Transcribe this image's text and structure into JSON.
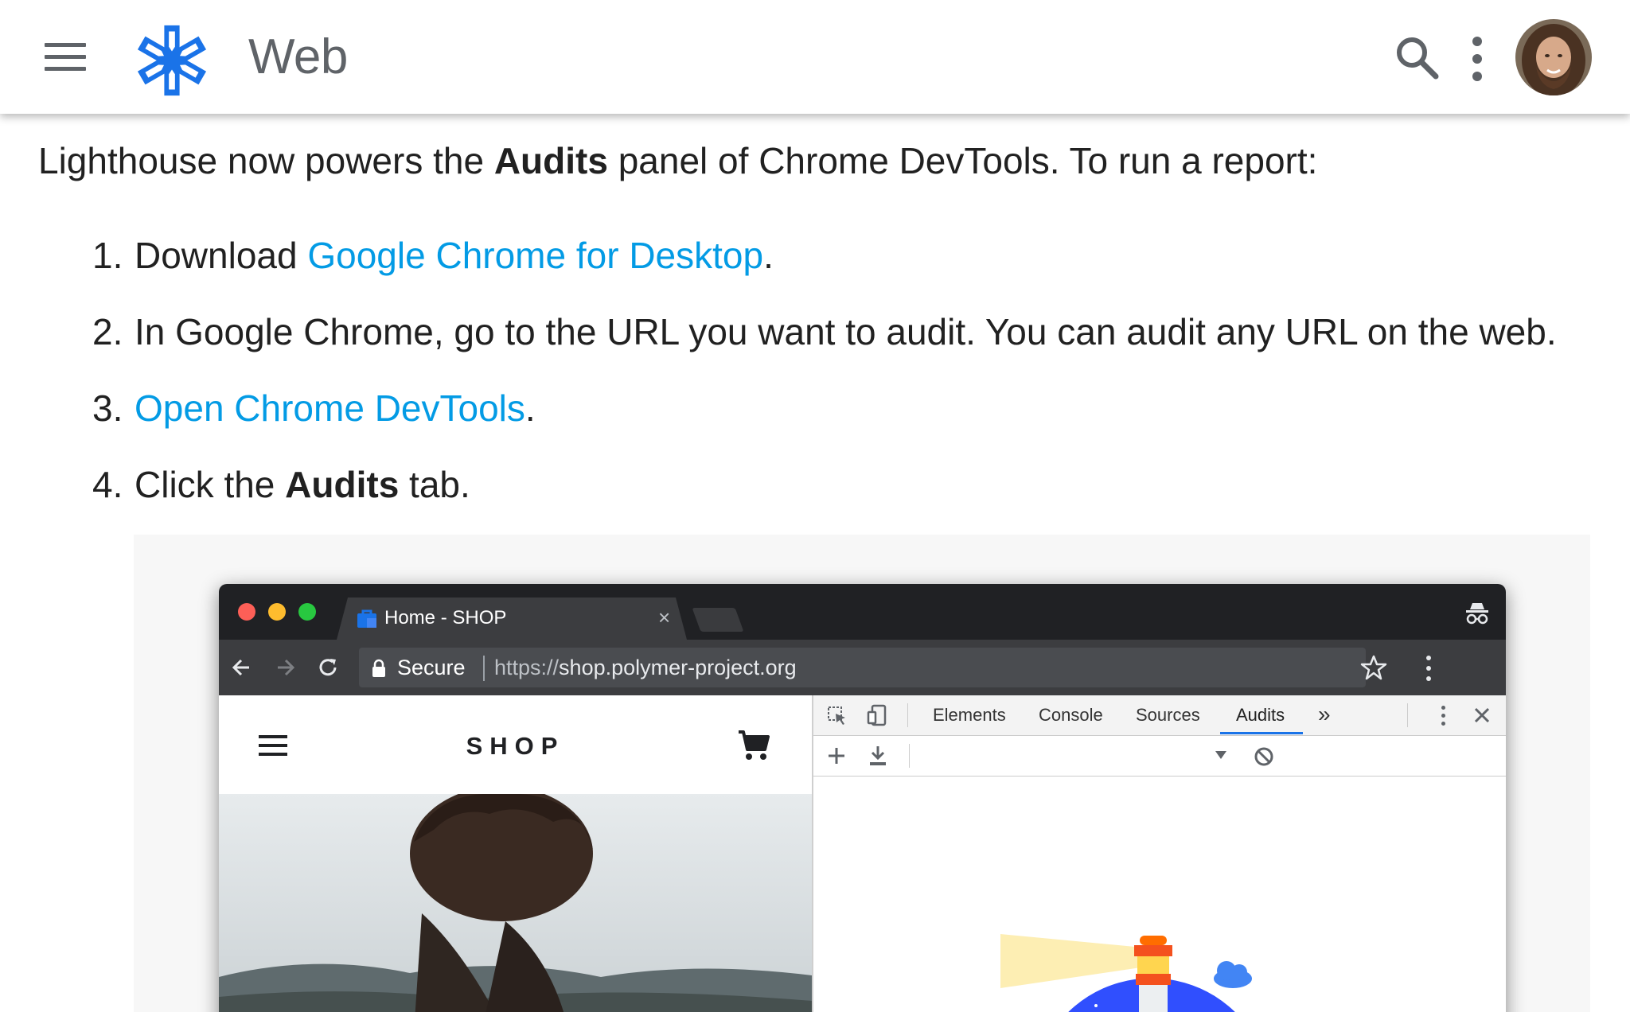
{
  "header": {
    "title": "Web",
    "icons": [
      "menu-icon",
      "site-logo-icon",
      "search-icon",
      "more-vert-icon",
      "avatar"
    ],
    "accent": "#1a73e8"
  },
  "article": {
    "intro": {
      "before": "Lighthouse now powers the ",
      "bold": "Audits",
      "after": " panel of Chrome DevTools. To run a report:"
    },
    "steps": [
      {
        "num": "1.",
        "before": "Download ",
        "link": "Google Chrome for Desktop",
        "after": "."
      },
      {
        "num": "2.",
        "text": "In Google Chrome, go to the URL you want to audit. You can audit any URL on the web."
      },
      {
        "num": "3.",
        "link": "Open Chrome DevTools",
        "after": "."
      },
      {
        "num": "4.",
        "before": "Click the ",
        "bold": "Audits",
        "after": " tab."
      }
    ],
    "link_color": "#039be5"
  },
  "screenshot": {
    "tab_title": "Home - SHOP",
    "tab_close": "×",
    "secure_label": "Secure",
    "url_scheme": "https://",
    "url_rest": "shop.polymer-project.org",
    "shop_title": "SHOP",
    "devtools_tabs": [
      "Elements",
      "Console",
      "Sources",
      "Audits"
    ],
    "devtools_more": "»",
    "active_tab": "Audits",
    "traffic_colors": [
      "#fd5f57",
      "#febc2e",
      "#28c840"
    ]
  }
}
